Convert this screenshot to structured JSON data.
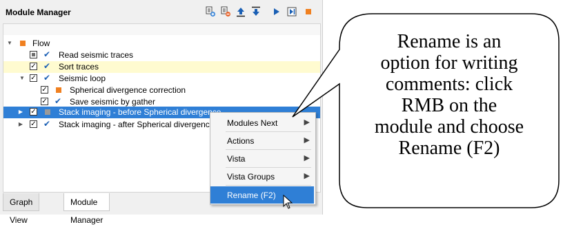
{
  "panel": {
    "title": "Module Manager",
    "toolbar_icons": [
      "add-module-icon",
      "remove-module-icon",
      "move-up-icon",
      "move-down-icon",
      "run-icon",
      "run-step-icon",
      "stop-icon"
    ],
    "tree": [
      {
        "label": "Flow",
        "level": 0,
        "expanded": true,
        "checkbox": "none",
        "marker": "orange-square"
      },
      {
        "label": "Read seismic traces",
        "level": 1,
        "checkbox": "partial",
        "marker": "checkmark"
      },
      {
        "label": "Sort traces",
        "level": 1,
        "checkbox": "checked",
        "marker": "checkmark",
        "highlight": "yellow"
      },
      {
        "label": "Seismic loop",
        "level": 1,
        "expanded": true,
        "checkbox": "checked",
        "marker": "checkmark"
      },
      {
        "label": "Spherical divergence correction",
        "level": 2,
        "checkbox": "checked",
        "marker": "orange-square"
      },
      {
        "label": "Save seismic by gather",
        "level": 2,
        "checkbox": "checked",
        "marker": "checkmark"
      },
      {
        "label": "Stack imaging - before Spherical divergence",
        "level": 1,
        "expanded": false,
        "checkbox": "checked",
        "marker": "grey-square",
        "highlight": "selected"
      },
      {
        "label": "Stack imaging - after Spherical divergence",
        "level": 1,
        "expanded": false,
        "checkbox": "checked",
        "marker": "checkmark"
      }
    ],
    "tabs": [
      {
        "label": "Graph View",
        "active": false
      },
      {
        "label": "Module Manager",
        "active": true
      }
    ]
  },
  "context_menu": {
    "items": [
      {
        "label": "Modules Next",
        "submenu": true
      },
      {
        "label": "Actions",
        "submenu": true
      },
      {
        "label": "Vista",
        "submenu": true
      },
      {
        "label": "Vista Groups",
        "submenu": true
      },
      {
        "label": "Rename (F2)",
        "submenu": false,
        "selected": true
      }
    ]
  },
  "callout": {
    "lines": [
      "Rename is an",
      "option for writing",
      "comments: click",
      "RMB on the",
      "module and choose",
      "Rename (F2)"
    ]
  },
  "colors": {
    "selection_blue": "#2f7fd6",
    "row_yellow": "#fffbd0",
    "accent_orange": "#f08020",
    "check_blue": "#1a5fb4"
  }
}
